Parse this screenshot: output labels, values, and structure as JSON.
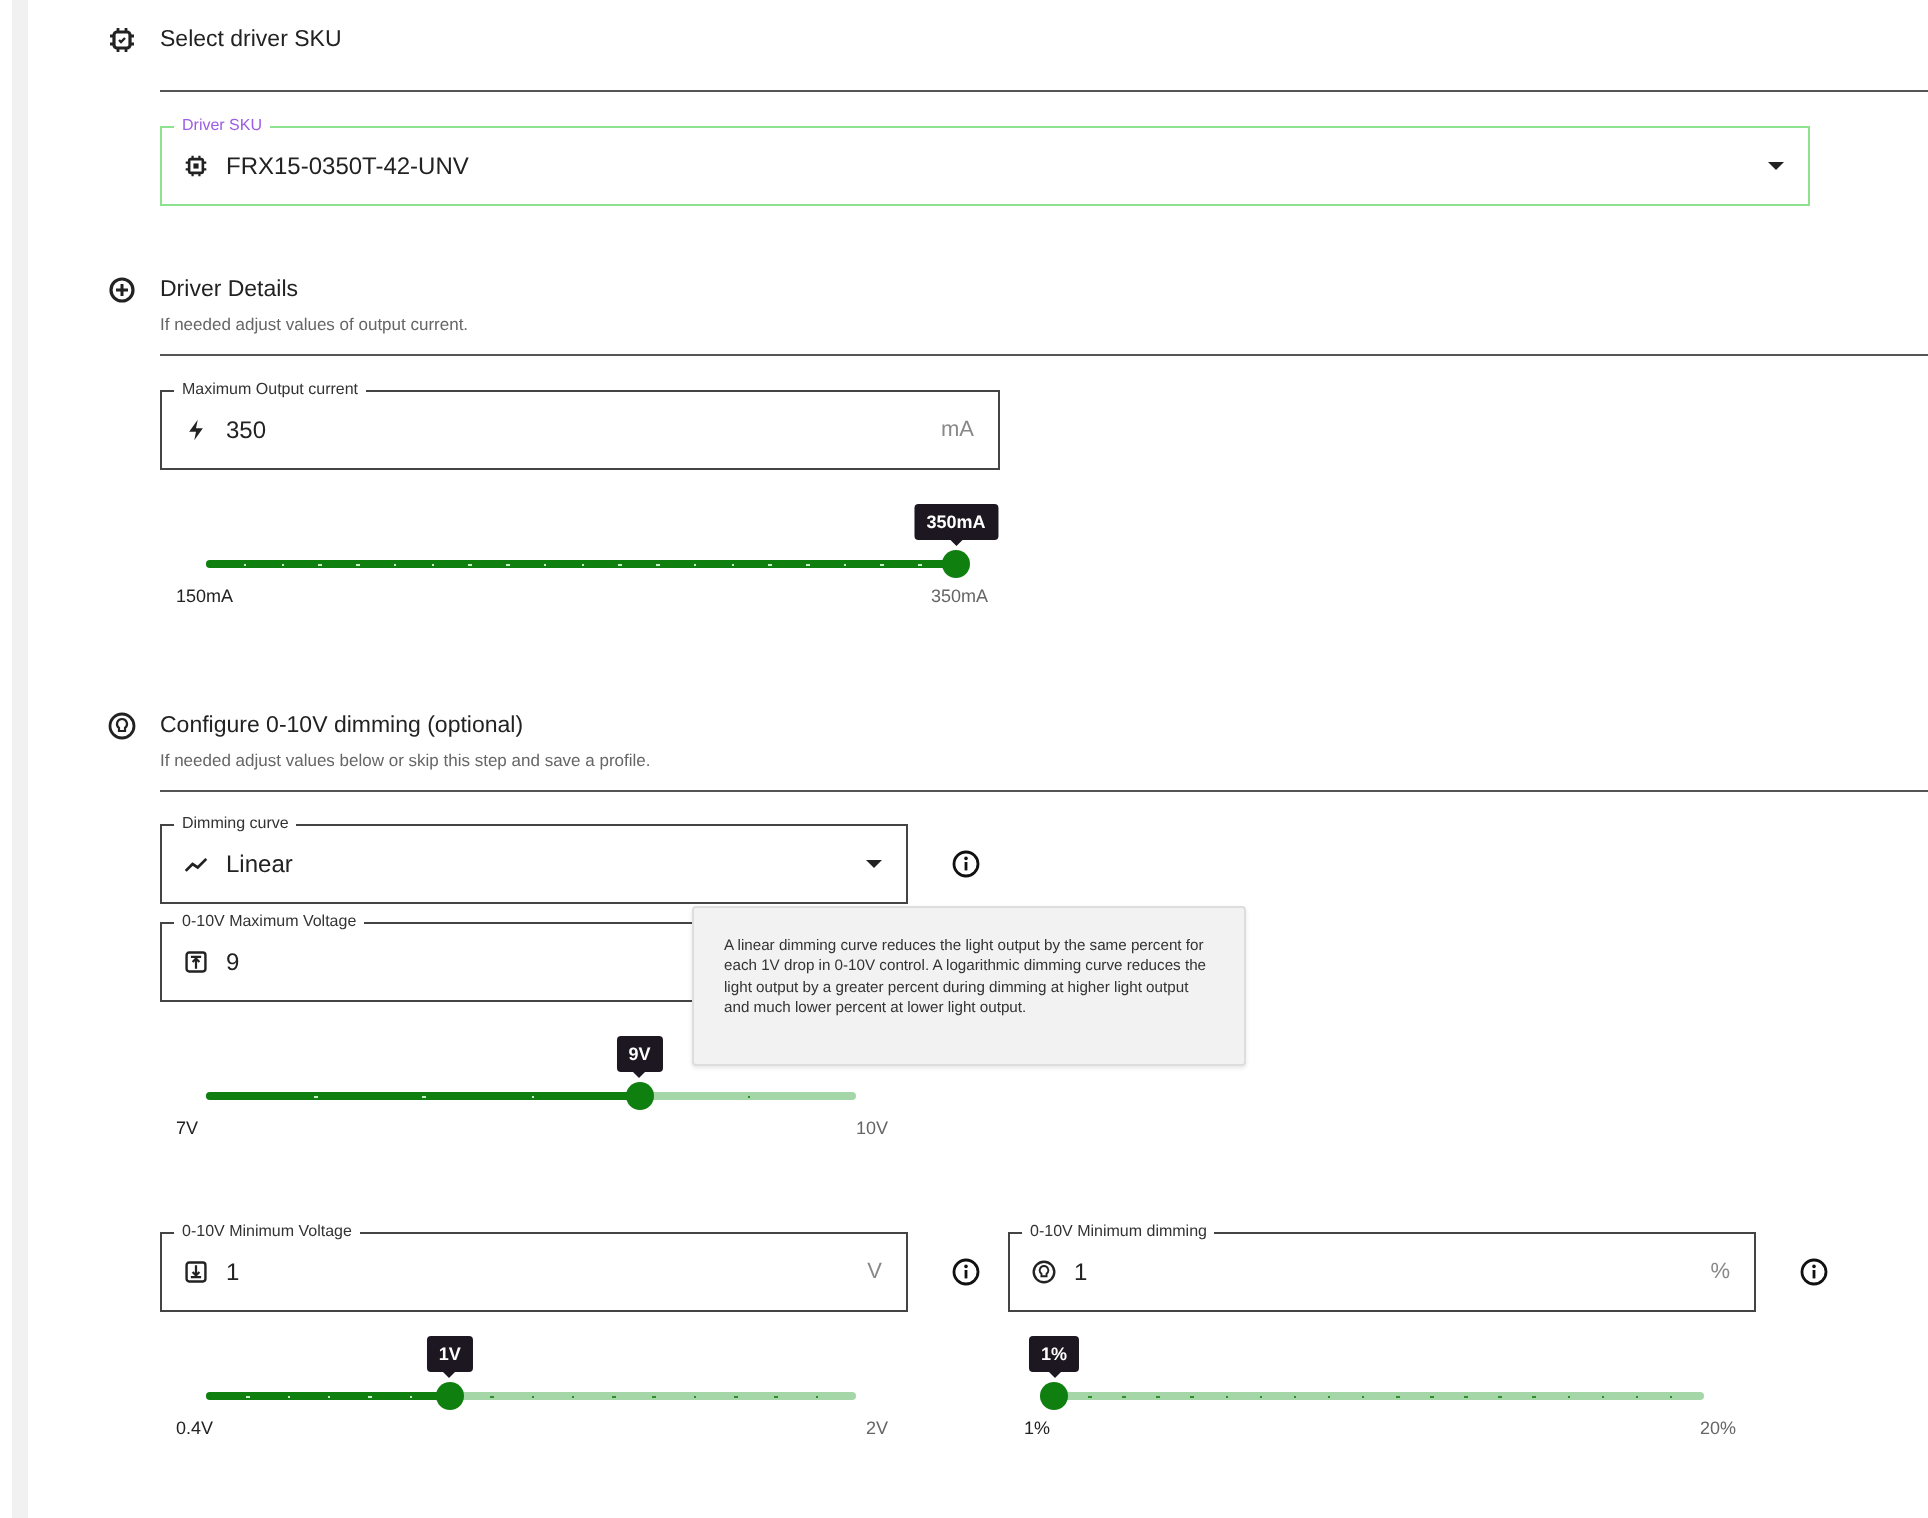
{
  "sku_section": {
    "title": "Select driver SKU",
    "field": {
      "label": "Driver SKU",
      "value": "FRX15-0350T-42-UNV",
      "focused": true
    }
  },
  "details_section": {
    "title": "Driver Details",
    "subtitle": "If needed adjust values of output current.",
    "current_field": {
      "label": "Maximum Output current",
      "value": "350",
      "unit": "mA"
    },
    "current_slider": {
      "level": 1,
      "value_label": "350mA",
      "min_label": "150mA",
      "max_label": "350mA"
    }
  },
  "dimming_section": {
    "title": "Configure 0-10V dimming (optional)",
    "subtitle": "If needed adjust values below or skip this step and save a profile.",
    "curve_field": {
      "label": "Dimming curve",
      "value": "Linear"
    },
    "tooltip": {
      "text": "A linear dimming curve reduces the light output by the same percent for each 1V drop in 0-10V control. A logarithmic dimming curve reduces the light output by a greater percent during dimming at higher light output and much lower percent at lower light output."
    },
    "max_voltage_field": {
      "label": "0-10V Maximum Voltage",
      "value": "9"
    },
    "max_voltage_slider": {
      "level": 0.667,
      "value_label": "9V",
      "min_label": "7V",
      "max_label": "10V"
    },
    "min_voltage_field": {
      "label": "0-10V Minimum Voltage",
      "value": "1",
      "unit": "V"
    },
    "min_voltage_slider": {
      "level": 0.375,
      "value_label": "1V",
      "min_label": "0.4V",
      "max_label": "2V"
    },
    "min_dimming_field": {
      "label": "0-10V Minimum dimming",
      "value": "1",
      "unit": "%"
    },
    "min_dimming_slider": {
      "level": 0,
      "value_label": "1%",
      "min_label": "1%",
      "max_label": "20%"
    }
  }
}
